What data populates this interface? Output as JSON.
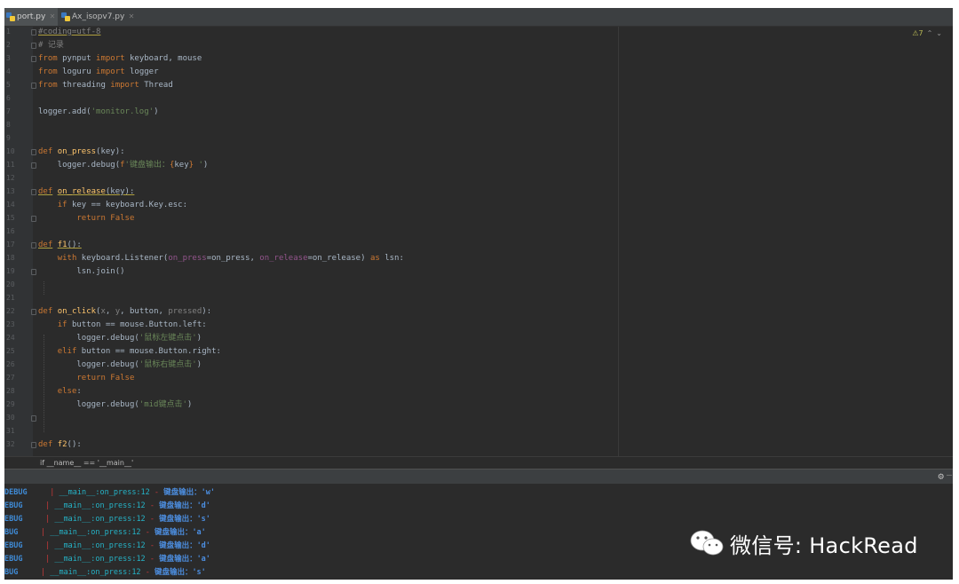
{
  "tabs": [
    {
      "label": "port.py"
    },
    {
      "label": "Ax_isopv7.py"
    }
  ],
  "warnings": {
    "count": "7"
  },
  "line_numbers": [
    "1",
    "2",
    "3",
    "4",
    "5",
    "6",
    "7",
    "8",
    "9",
    "10",
    "11",
    "12",
    "13",
    "14",
    "15",
    "16",
    "17",
    "18",
    "19",
    "20",
    "21",
    "22",
    "23",
    "24",
    "25",
    "26",
    "27",
    "28",
    "29",
    "30",
    "31",
    "32"
  ],
  "code_lines": [
    "#coding=utf-8",
    "# 记录",
    "from pynput import keyboard, mouse",
    "from loguru import logger",
    "from threading import Thread",
    "",
    "logger.add('monitor.log')",
    "",
    "",
    "def on_press(key):",
    "    logger.debug(f'键盘输出：{key} ')",
    "",
    "def on_release(key):",
    "    if key == keyboard.Key.esc:",
    "        return False",
    "",
    "def f1():",
    "    with keyboard.Listener(on_press=on_press, on_release=on_release) as lsn:",
    "        lsn.join()",
    "",
    "",
    "def on_click(x, y, button, pressed):",
    "    if button == mouse.Button.left:",
    "        logger.debug('鼠标左键点击')",
    "    elif button == mouse.Button.right:",
    "        logger.debug('鼠标右键点击')",
    "        return False",
    "    else:",
    "        logger.debug('mid键点击')",
    "",
    "",
    "def f2():"
  ],
  "breadcrumb": "if __name__ == '__main__'",
  "console_lines": [
    {
      "level": "DEBUG",
      "pipe": "|",
      "source": "__main__:on_press:12",
      "sep": "-",
      "message": "键盘输出：'w'"
    },
    {
      "level": "EBUG",
      "pipe": "|",
      "source": "__main__:on_press:12",
      "sep": "-",
      "message": "键盘输出：'d'"
    },
    {
      "level": "EBUG",
      "pipe": "|",
      "source": "__main__:on_press:12",
      "sep": "-",
      "message": "键盘输出：'s'"
    },
    {
      "level": "BUG",
      "pipe": "|",
      "source": "__main__:on_press:12",
      "sep": "-",
      "message": "键盘输出：'a'"
    },
    {
      "level": "EBUG",
      "pipe": "|",
      "source": "__main__:on_press:12",
      "sep": "-",
      "message": "键盘输出：'d'"
    },
    {
      "level": "EBUG",
      "pipe": "|",
      "source": "__main__:on_press:12",
      "sep": "-",
      "message": "键盘输出：'a'"
    },
    {
      "level": "BUG",
      "pipe": "|",
      "source": "__main__:on_press:12",
      "sep": "-",
      "message": "键盘输出：'s'"
    }
  ],
  "watermark": {
    "text": "微信号: HackRead"
  },
  "colors": {
    "keyword": "#cc7832",
    "function": "#ffc66d",
    "string": "#6a8759",
    "log_level": "#3f8bd6",
    "log_source": "#25b3c7",
    "log_pipe": "#cc3a3a"
  }
}
